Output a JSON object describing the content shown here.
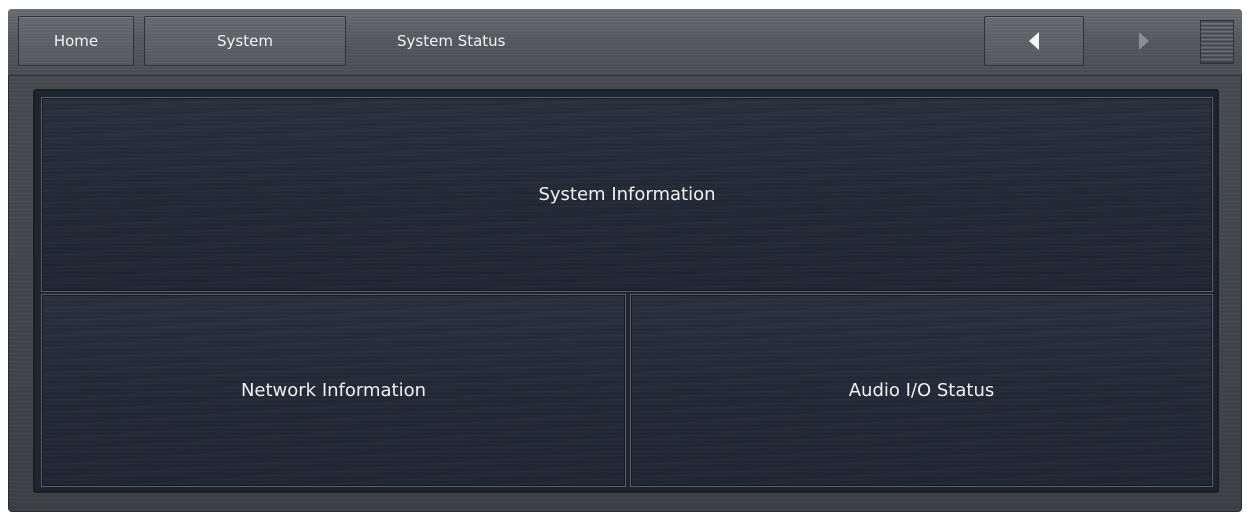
{
  "topbar": {
    "tabs": [
      {
        "label": "Home"
      },
      {
        "label": "System"
      }
    ],
    "page_title": "System Status",
    "nav": {
      "back_icon": "triangle-left-icon",
      "forward_icon": "triangle-right-icon",
      "menu_icon": "hamburger-lines-icon"
    }
  },
  "tiles": {
    "system_information": "System Information",
    "network_information": "Network Information",
    "audio_io_status": "Audio I/O Status"
  },
  "colors": {
    "tile_background": "#222a37",
    "tile_text": "#f0f0f0",
    "bar_background": "#55585d",
    "forward_icon_dim": "#8a8d92"
  }
}
